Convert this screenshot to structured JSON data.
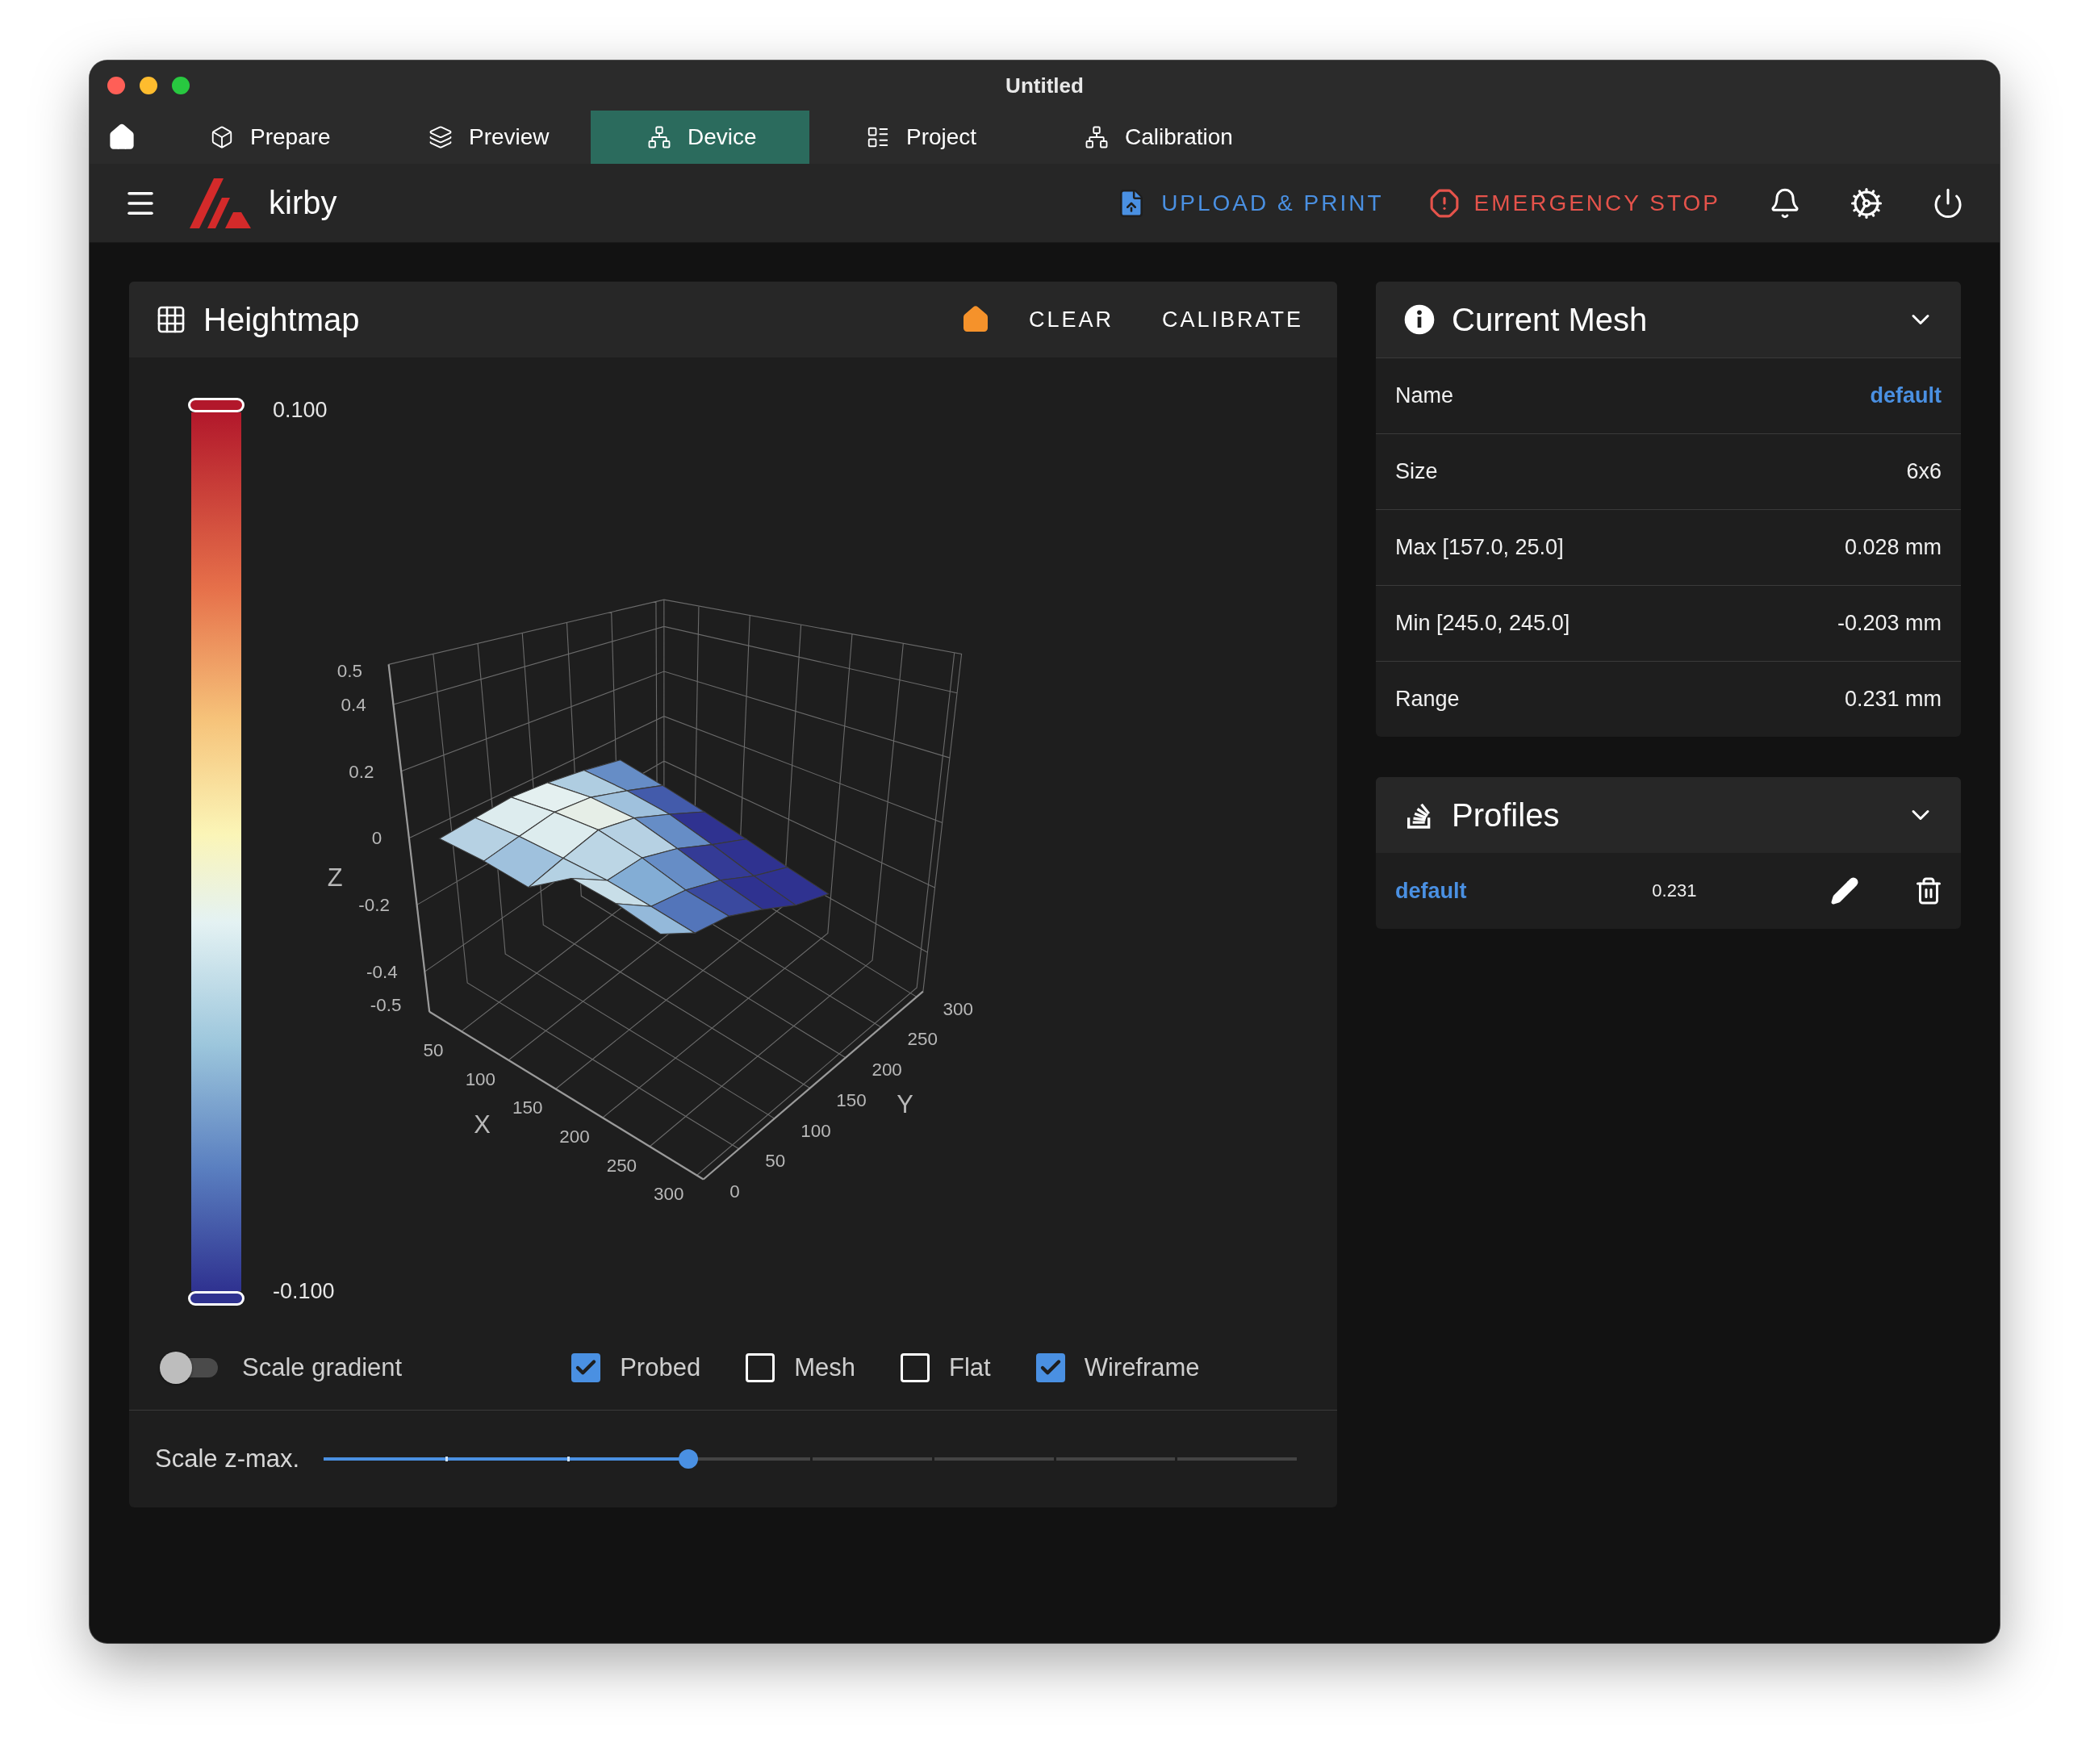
{
  "window": {
    "title": "Untitled"
  },
  "tabs": [
    {
      "label": "Prepare",
      "selected": false
    },
    {
      "label": "Preview",
      "selected": false
    },
    {
      "label": "Device",
      "selected": true
    },
    {
      "label": "Project",
      "selected": false
    },
    {
      "label": "Calibration",
      "selected": false
    }
  ],
  "app_bar": {
    "printer_name": "kirby",
    "actions": [
      {
        "label": "UPLOAD & PRINT",
        "kind": "primary"
      },
      {
        "label": "EMERGENCY STOP",
        "kind": "danger"
      }
    ]
  },
  "heightmap": {
    "title": "Heightmap",
    "buttons": [
      "CLEAR",
      "CALIBRATE"
    ],
    "colorbar": {
      "max": "0.100",
      "min": "-0.100"
    },
    "plot": {
      "z_title": "Z",
      "z_ticks": [
        "0.5",
        "0.4",
        "0.2",
        "0",
        "-0.2",
        "-0.4",
        "-0.5"
      ],
      "x_title": "X",
      "x_ticks": [
        "50",
        "100",
        "150",
        "200",
        "250",
        "300"
      ],
      "y_title": "Y",
      "y_ticks": [
        "0",
        "50",
        "100",
        "150",
        "200",
        "250",
        "300"
      ]
    },
    "options": [
      {
        "kind": "switch",
        "label": "Scale gradient",
        "on": false
      },
      {
        "kind": "checkbox",
        "label": "Probed",
        "checked": true
      },
      {
        "kind": "checkbox",
        "label": "Mesh",
        "checked": false
      },
      {
        "kind": "checkbox",
        "label": "Flat",
        "checked": false
      },
      {
        "kind": "checkbox",
        "label": "Wireframe",
        "checked": true
      }
    ],
    "slider": {
      "label": "Scale z-max.",
      "level": 0.375
    }
  },
  "current_mesh": {
    "title": "Current Mesh",
    "rows": [
      {
        "label": "Name",
        "value": "default",
        "kind": "link"
      },
      {
        "label": "Size",
        "value": "6x6",
        "kind": "text"
      },
      {
        "label": "Max [157.0, 25.0]",
        "value": "0.028 mm",
        "kind": "text"
      },
      {
        "label": "Min [245.0, 245.0]",
        "value": "-0.203 mm",
        "kind": "text"
      },
      {
        "label": "Range",
        "value": "0.231 mm",
        "kind": "text"
      }
    ]
  },
  "profiles": {
    "title": "Profiles",
    "items": [
      {
        "name": "default",
        "range": "0.231"
      }
    ]
  }
}
